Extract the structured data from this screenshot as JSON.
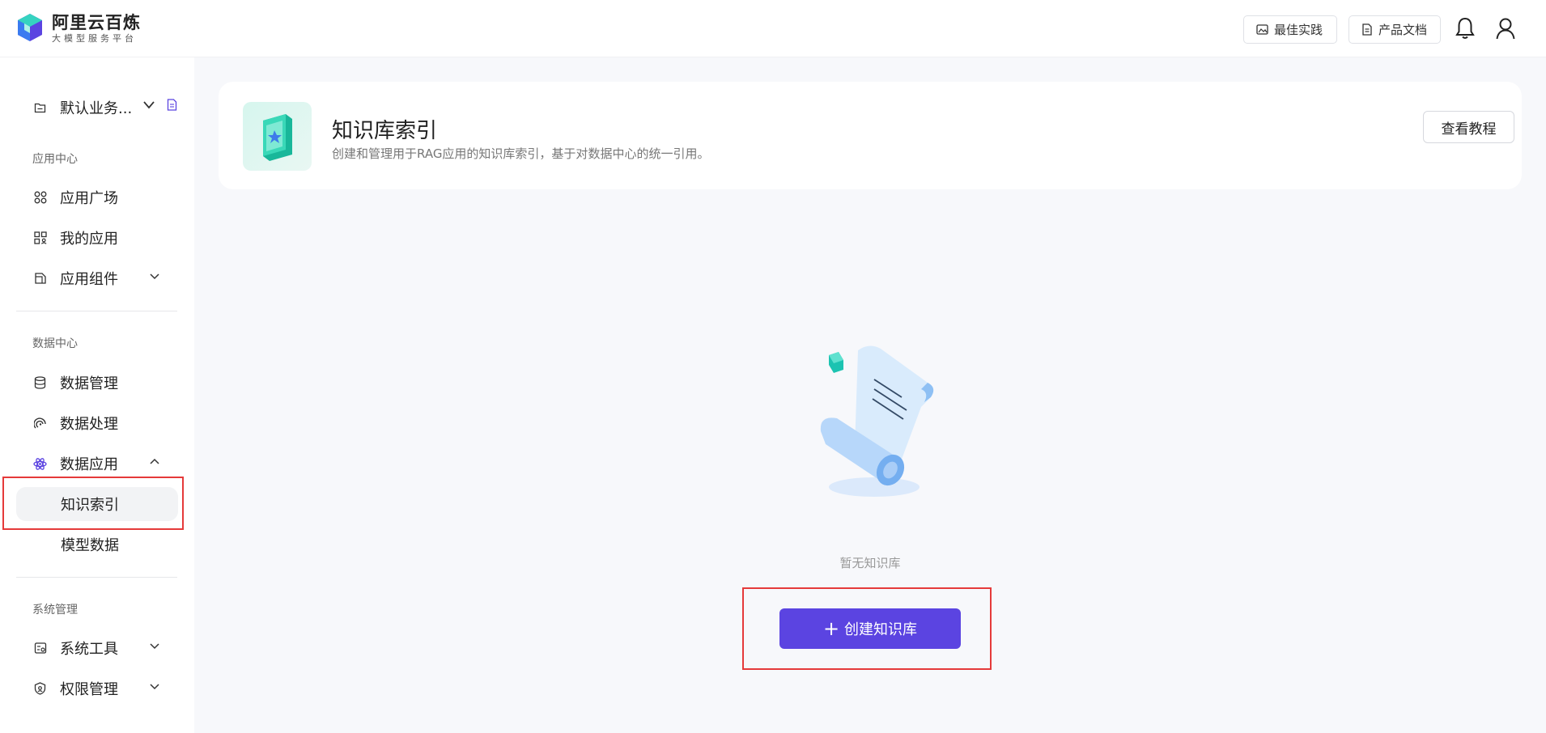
{
  "brand": {
    "title": "阿里云百炼",
    "subtitle": "大模型服务平台",
    "colors": {
      "primary": "#5b44e1",
      "highlight": "#e53a3a"
    }
  },
  "header": {
    "best_practice": "最佳实践",
    "product_docs": "产品文档"
  },
  "sidebar": {
    "workspace": "默认业务...",
    "sections": {
      "app_center": "应用中心",
      "data_center": "数据中心",
      "system": "系统管理"
    },
    "items": {
      "app_plaza": "应用广场",
      "my_apps": "我的应用",
      "app_components": "应用组件",
      "data_management": "数据管理",
      "data_processing": "数据处理",
      "data_applications": "数据应用",
      "knowledge_index": "知识索引",
      "model_data": "模型数据",
      "system_tools": "系统工具",
      "permission_management": "权限管理"
    }
  },
  "main": {
    "title": "知识库索引",
    "description": "创建和管理用于RAG应用的知识库索引，基于对数据中心的统一引用。",
    "tutorial_button": "查看教程",
    "empty_text": "暂无知识库",
    "create_button": "创建知识库",
    "create_icon": "+"
  }
}
